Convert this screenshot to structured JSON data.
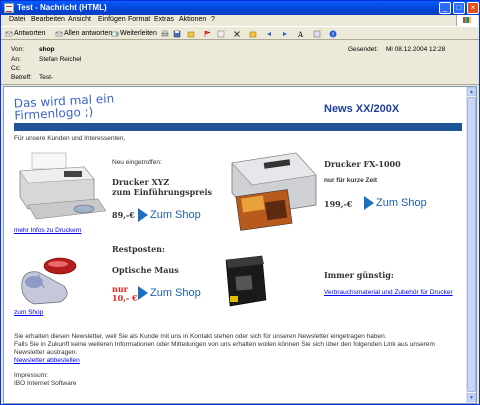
{
  "window": {
    "title": "Test - Nachricht (HTML)",
    "controls": {
      "minimize": "_",
      "maximize": "□",
      "close": "×"
    }
  },
  "menu": [
    "Datei",
    "Bearbeiten",
    "Ansicht",
    "Einfügen",
    "Format",
    "Extras",
    "Aktionen",
    "?"
  ],
  "toolbar": {
    "reply": "Antworten",
    "reply_all": "Allen antworten",
    "forward": "Weiterleiten"
  },
  "headers": {
    "from_label": "Von:",
    "from_value": "shop",
    "to_label": "An:",
    "to_value": "Stefan Reichel",
    "cc_label": "Cc:",
    "cc_value": "",
    "subject_label": "Betreff:",
    "subject_value": "Test-",
    "sent_label": "Gesendet:",
    "sent_value": "Mi 08.12.2004 12:28"
  },
  "newsletter": {
    "logo_line1": "Das wird mal ein",
    "logo_line2": "Firmenlogo ;)",
    "title": "News XX/200X",
    "intro": "Für unsere Kunden und Interessenten,",
    "new_label": "Neu eingetroffen:",
    "product1_line1": "Drucker XYZ",
    "product1_line2": "zum Einführungspreis",
    "product1_price": "89,-€",
    "shop_label": "Zum Shop",
    "more_info_link": "mehr Infos zu Druckern",
    "product2_name": "Drucker FX-1000",
    "product2_sub": "nur für kurze Zeit",
    "product2_price": "199,-€",
    "clearance_label": "Restposten:",
    "mouse_name": "Optische Maus",
    "mouse_price_line1": "nur",
    "mouse_price_line2": "10,- €",
    "mouse_link": "zum Shop",
    "always_cheap": "Immer günstig:",
    "consumables_link": "Verbrauchsmaterial und Zubehör für Drucker",
    "footer_line1": "Sie erhalten diesen Newsletter, weil Sie als Kunde mit uns in Kontakt stehen oder sich für unseren Newsletter eingetragen haben.",
    "footer_line2": "Falls Sie in Zukunft keine weiteren Informationen oder Mitteilungen von uns erhalten wollen können Sie sich über den folgenden Link aus unserem",
    "footer_line3": "Newsletter austragen:",
    "unsubscribe_link": "Newsletter abbestellen",
    "imprint_label": "Impressum:",
    "imprint_value": "IBO Internet Software"
  },
  "colors": {
    "title_bar": "#0a5bff",
    "brand_blue": "#1f5496",
    "price_red": "#e8211c",
    "shop_blue": "#1e6fc2"
  }
}
